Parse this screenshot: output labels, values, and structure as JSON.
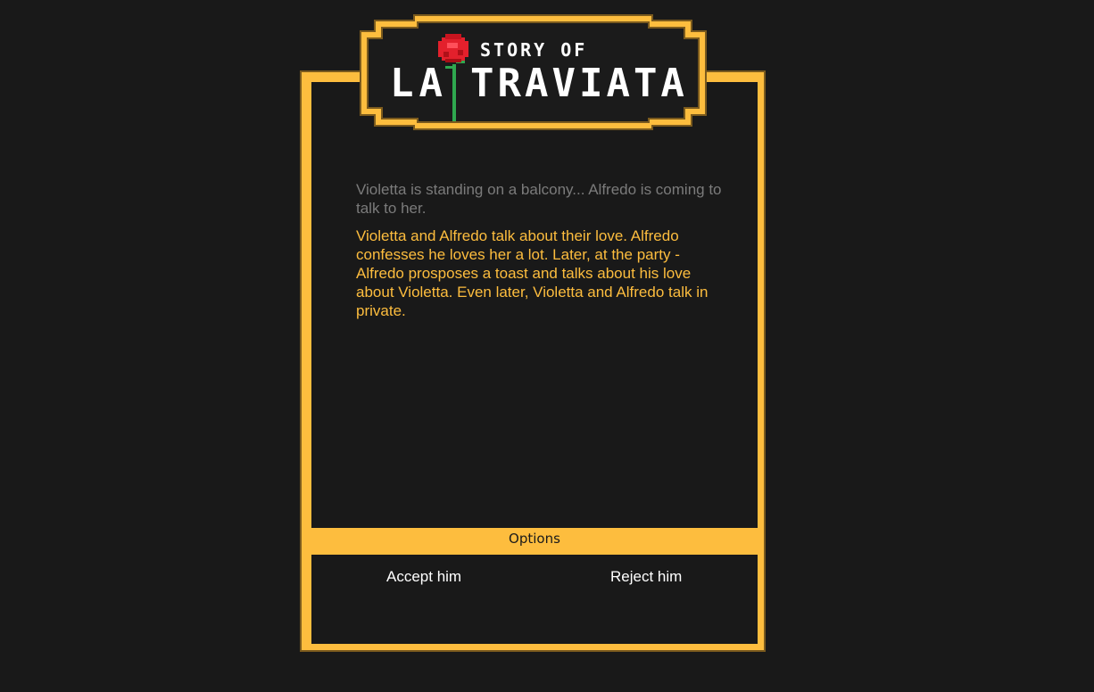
{
  "logo": {
    "line1": "STORY OF",
    "line2_left": "LA",
    "line2_right": "TRAVIATA"
  },
  "story": {
    "previous": "Violetta is standing on a balcony... Alfredo is coming to talk to her.",
    "current": "Violetta and Alfredo talk about their love. Alfredo confesses he loves her a lot. Later, at the party - Alfredo prosposes a toast and talks about his love about Violetta. Even later, Violetta and Alfredo talk in private."
  },
  "options": {
    "label": "Options",
    "choices": [
      {
        "label": "Accept him"
      },
      {
        "label": "Reject him"
      }
    ]
  },
  "colors": {
    "background": "#191919",
    "frame": "#fdbd3e",
    "frame_shadow": "#7a5a1e",
    "story_previous": "#7b7b7b",
    "story_current": "#fdbd3e",
    "rose": "#e3202c",
    "stem": "#2fa84f"
  }
}
